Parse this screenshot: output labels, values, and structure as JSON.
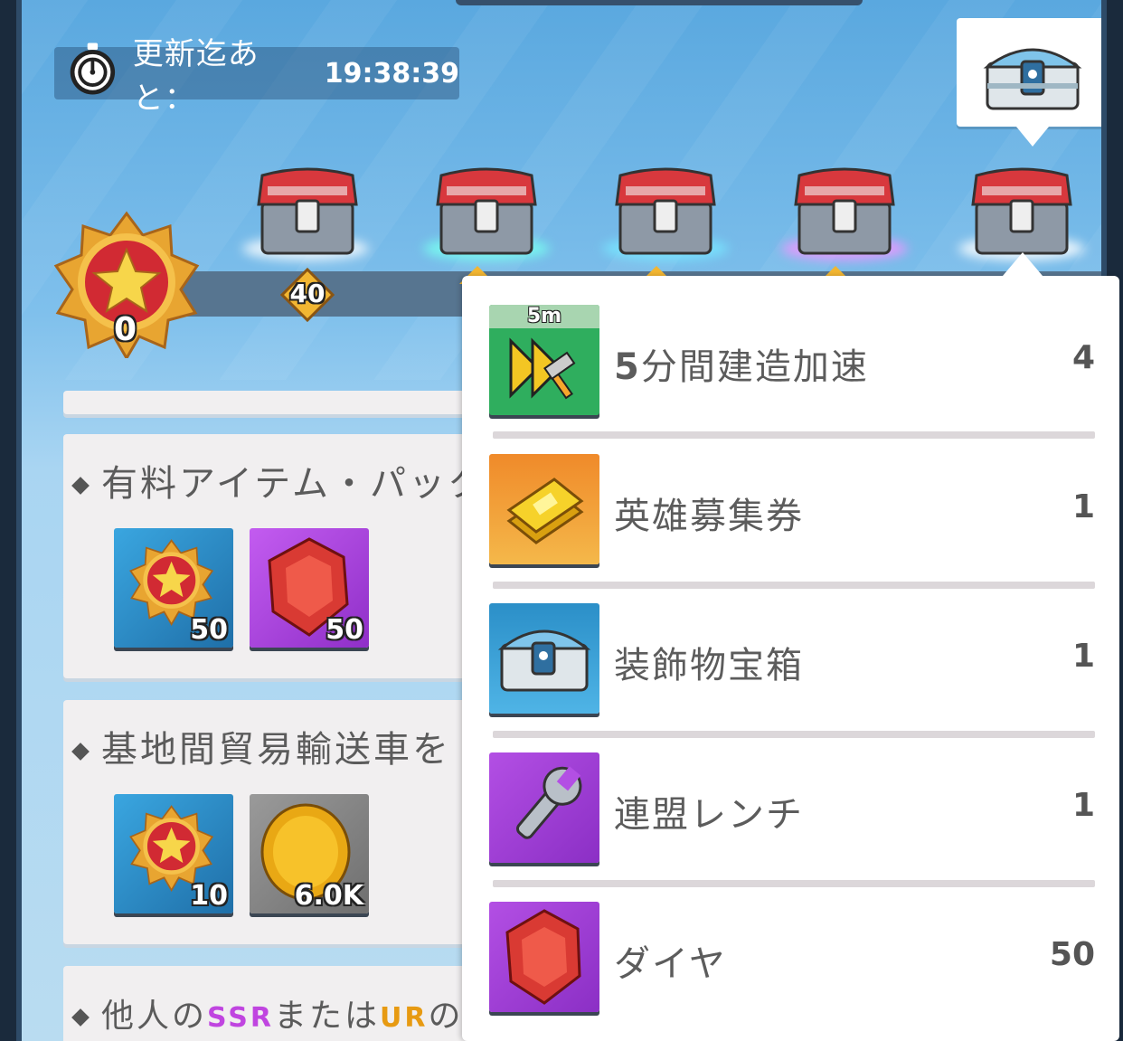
{
  "timer": {
    "label": "更新迄あと：",
    "value": "19:38:39"
  },
  "progress": {
    "current_points": "0",
    "milestones": [
      "40"
    ]
  },
  "sections": [
    {
      "title": "有料アイテム・パック",
      "rewards": [
        {
          "icon": "medal-icon",
          "count": "50"
        },
        {
          "icon": "gem-icon",
          "count": "50"
        }
      ]
    },
    {
      "title": "基地間貿易輸送車を",
      "rewards": [
        {
          "icon": "medal-icon",
          "count": "10"
        },
        {
          "icon": "coin-icon",
          "count": "6.0K"
        }
      ]
    },
    {
      "title_pre": "他人の",
      "title_ssr": "SSR",
      "title_mid": "または",
      "title_ur": "UR",
      "title_post": "の極秘"
    }
  ],
  "popup": {
    "items": [
      {
        "icon": "build-speedup-icon",
        "badge": "5m",
        "name_num": "5",
        "name": "分間建造加速",
        "qty": "4"
      },
      {
        "icon": "hero-ticket-icon",
        "name": "英雄募集券",
        "qty": "1"
      },
      {
        "icon": "decoration-chest-icon",
        "name": "装飾物宝箱",
        "qty": "1"
      },
      {
        "icon": "wrench-icon",
        "name": "連盟レンチ",
        "qty": "1"
      },
      {
        "icon": "gem-icon",
        "name": "ダイヤ",
        "qty": "50"
      }
    ]
  },
  "colors": {
    "speedup": "#2fae5e",
    "ticket": "#f0a43a",
    "chest": "#3aa2d8",
    "purple": "#a23fd6",
    "blue_tile": "#2b8fc8",
    "coin_tile": "#8a8a8a"
  }
}
